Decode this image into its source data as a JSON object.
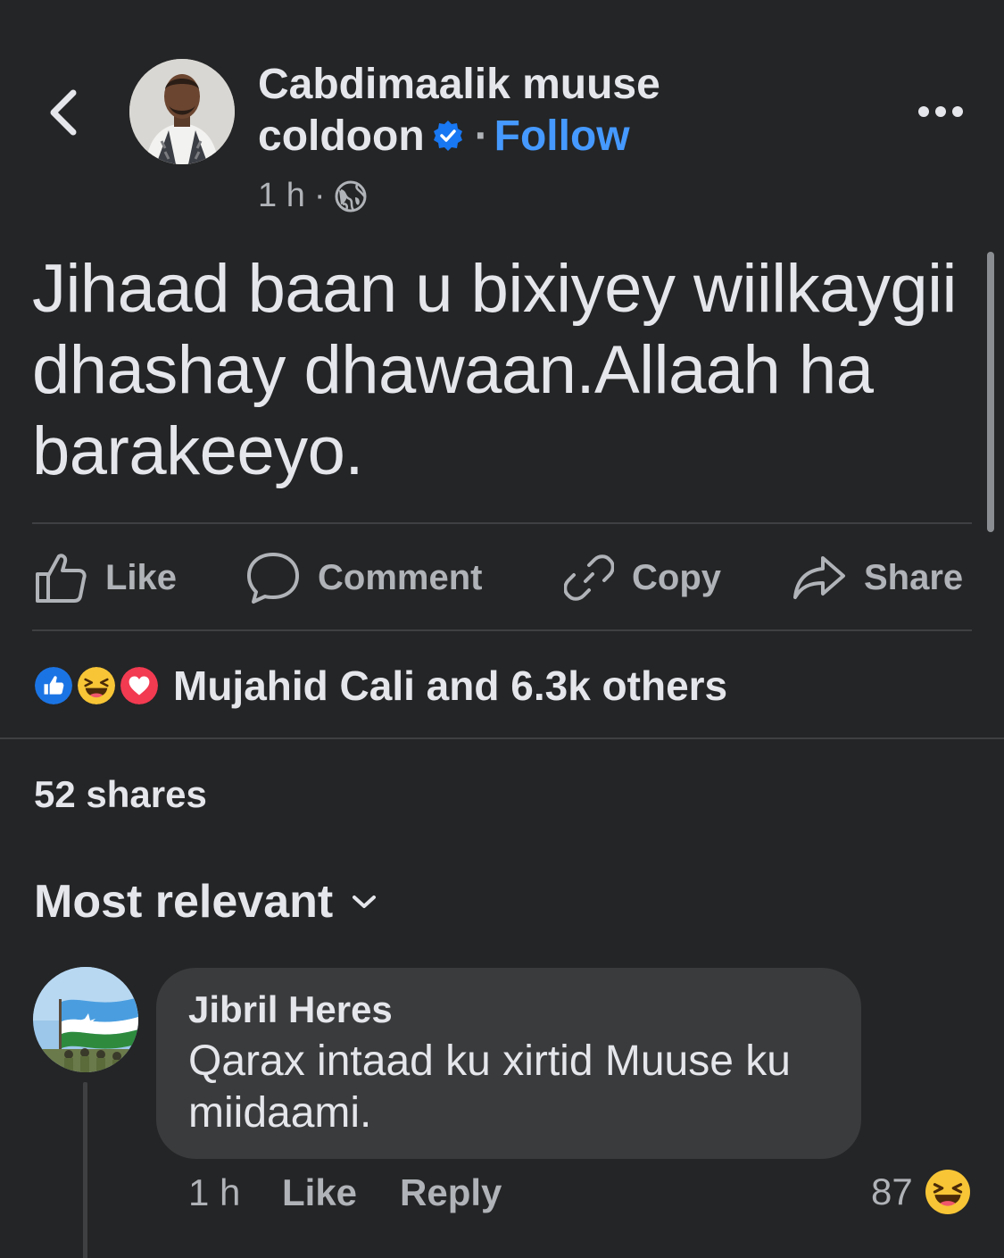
{
  "post": {
    "author": {
      "name_line1": "Cabdimaalik muuse",
      "name_line2": "coldoon",
      "follow_label": "Follow"
    },
    "time": "1 h",
    "audience_icon": "globe-icon",
    "text_lines": [
      "Jihaad baan u bixiyey wiilkaygii",
      "dhashay dhawaan.Allaah ha",
      "barakeeyo."
    ]
  },
  "actions": {
    "like": "Like",
    "comment": "Comment",
    "copy": "Copy",
    "share": "Share"
  },
  "reactions": {
    "types": [
      "like",
      "haha",
      "love"
    ],
    "summary": "Mujahid Cali and 6.3k others"
  },
  "shares": "52 shares",
  "sort_label": "Most relevant",
  "comments": [
    {
      "author": "Jibril Heres",
      "text": "Qarax intaad ku xirtid Muuse ku miidaami.",
      "time": "1 h",
      "like_label": "Like",
      "reply_label": "Reply",
      "reaction_count": "87",
      "reaction_type": "haha"
    }
  ],
  "colors": {
    "background": "#242526",
    "text": "#e4e6eb",
    "secondary_text": "#b0b3b8",
    "follow_blue": "#4599ff",
    "verified_blue": "#1877f2",
    "bubble": "#3a3b3c",
    "divider": "#3e4042"
  }
}
